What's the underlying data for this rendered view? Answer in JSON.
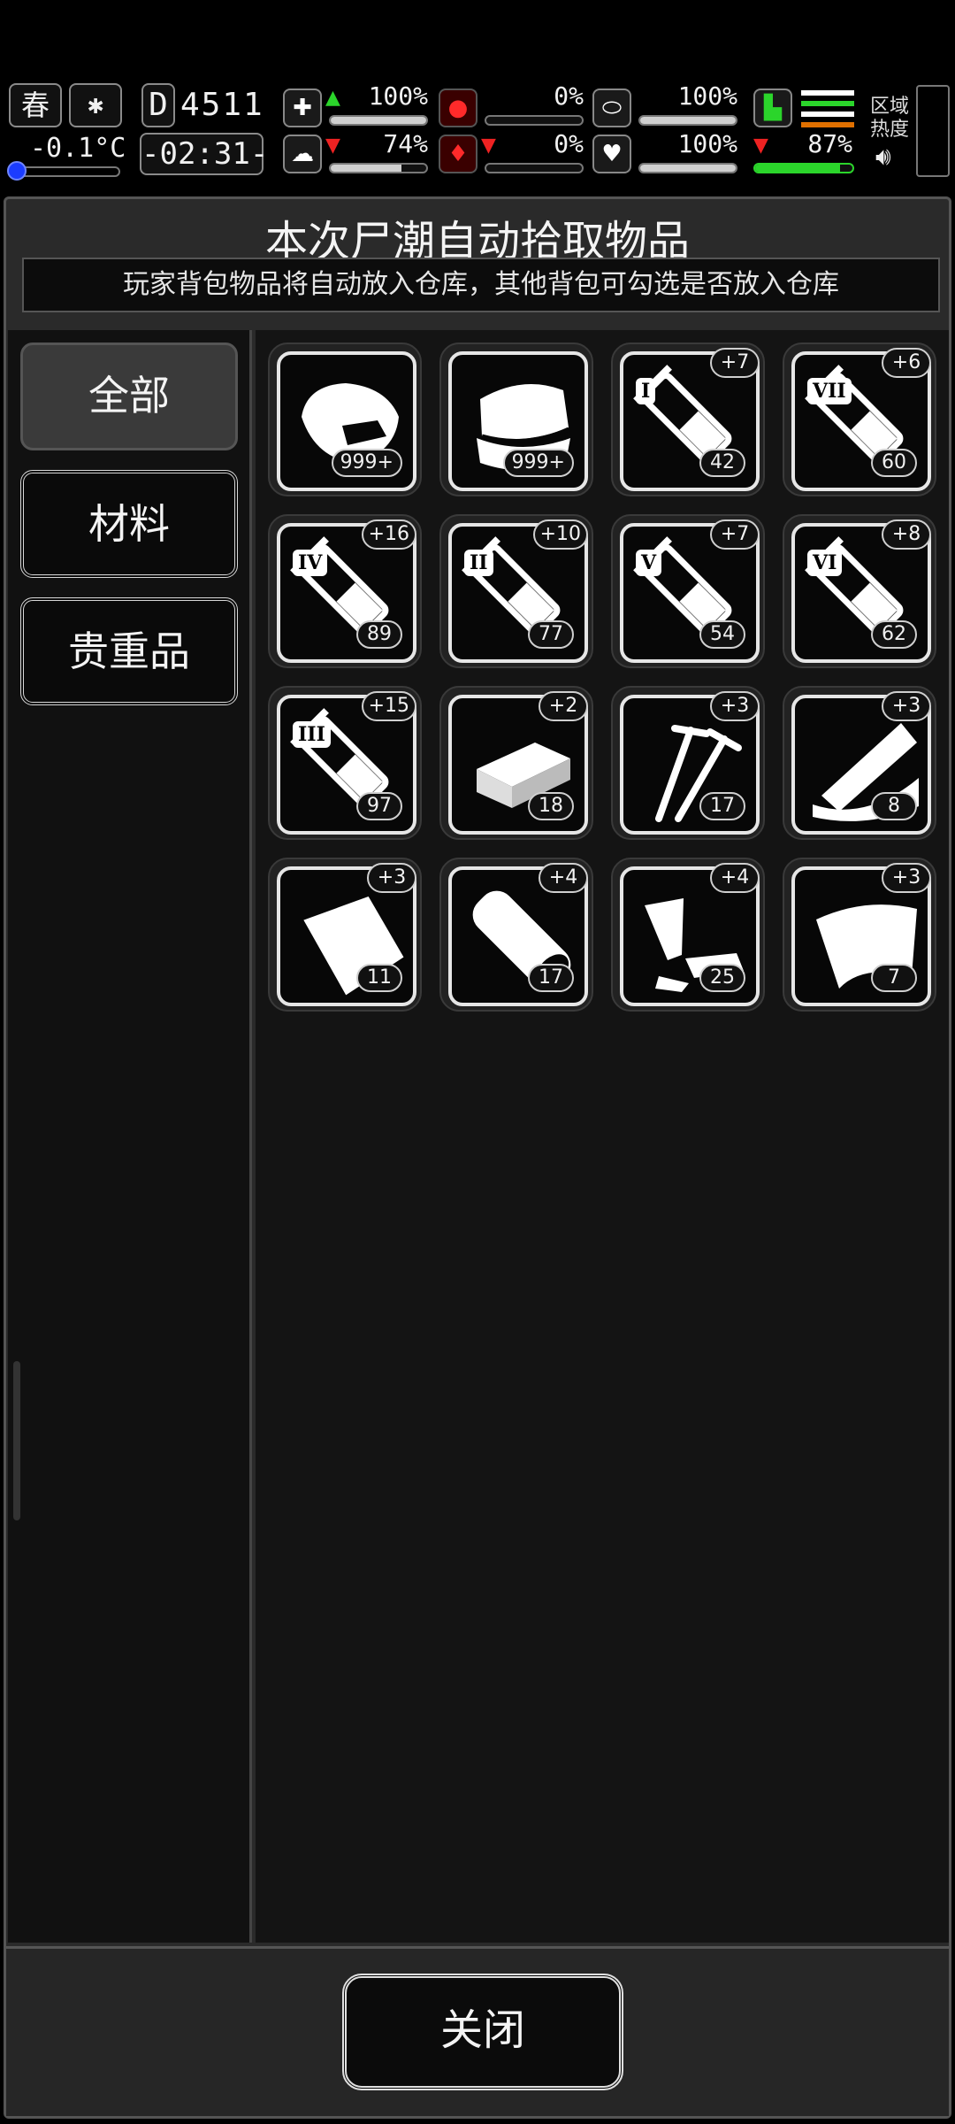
{
  "hud": {
    "season": "春",
    "weather_icon": "snow-icon",
    "temperature": "-0.1°C",
    "day_label": "D",
    "day_number": "4511",
    "clock": "-02:31-",
    "stats": {
      "health": "100%",
      "mood": "74%",
      "hunger": "0%",
      "thirst": "0%",
      "stamina": "100%",
      "heart": "100%",
      "energy": "87%"
    },
    "region_label_1": "区域",
    "region_label_2": "热度"
  },
  "panel": {
    "title": "本次尸潮自动拾取物品",
    "subtitle": "玩家背包物品将自动放入仓库，其他背包可勾选是否放入仓库"
  },
  "tabs": [
    {
      "label": "全部",
      "active": true
    },
    {
      "label": "材料",
      "active": false
    },
    {
      "label": "贵重品",
      "active": false
    }
  ],
  "items": [
    {
      "icon": "meat-icon",
      "count": "999+",
      "bonus": ""
    },
    {
      "icon": "cloth-icon",
      "count": "999+",
      "bonus": ""
    },
    {
      "icon": "syringe-icon",
      "roman": "I",
      "count": "42",
      "bonus": "+7"
    },
    {
      "icon": "syringe-icon",
      "roman": "VII",
      "count": "60",
      "bonus": "+6"
    },
    {
      "icon": "syringe-icon",
      "roman": "IV",
      "count": "89",
      "bonus": "+16"
    },
    {
      "icon": "syringe-icon",
      "roman": "II",
      "count": "77",
      "bonus": "+10"
    },
    {
      "icon": "syringe-icon",
      "roman": "V",
      "count": "54",
      "bonus": "+7"
    },
    {
      "icon": "syringe-icon",
      "roman": "VI",
      "count": "62",
      "bonus": "+8"
    },
    {
      "icon": "syringe-icon",
      "roman": "III",
      "count": "97",
      "bonus": "+15"
    },
    {
      "icon": "brick-icon",
      "count": "18",
      "bonus": "+2"
    },
    {
      "icon": "screws-icon",
      "count": "17",
      "bonus": "+3"
    },
    {
      "icon": "wood-scraps-icon",
      "count": "8",
      "bonus": "+3"
    },
    {
      "icon": "bag-icon",
      "count": "11",
      "bonus": "+3"
    },
    {
      "icon": "wood-log-icon",
      "count": "17",
      "bonus": "+4"
    },
    {
      "icon": "scrap-metal-icon",
      "count": "25",
      "bonus": "+4"
    },
    {
      "icon": "leather-icon",
      "count": "7",
      "bonus": "+3"
    }
  ],
  "footer": {
    "close_label": "关闭"
  },
  "colors": {
    "accent_green": "#2bd52b",
    "accent_red": "#e22222",
    "temp_blue": "#1b3cff"
  }
}
